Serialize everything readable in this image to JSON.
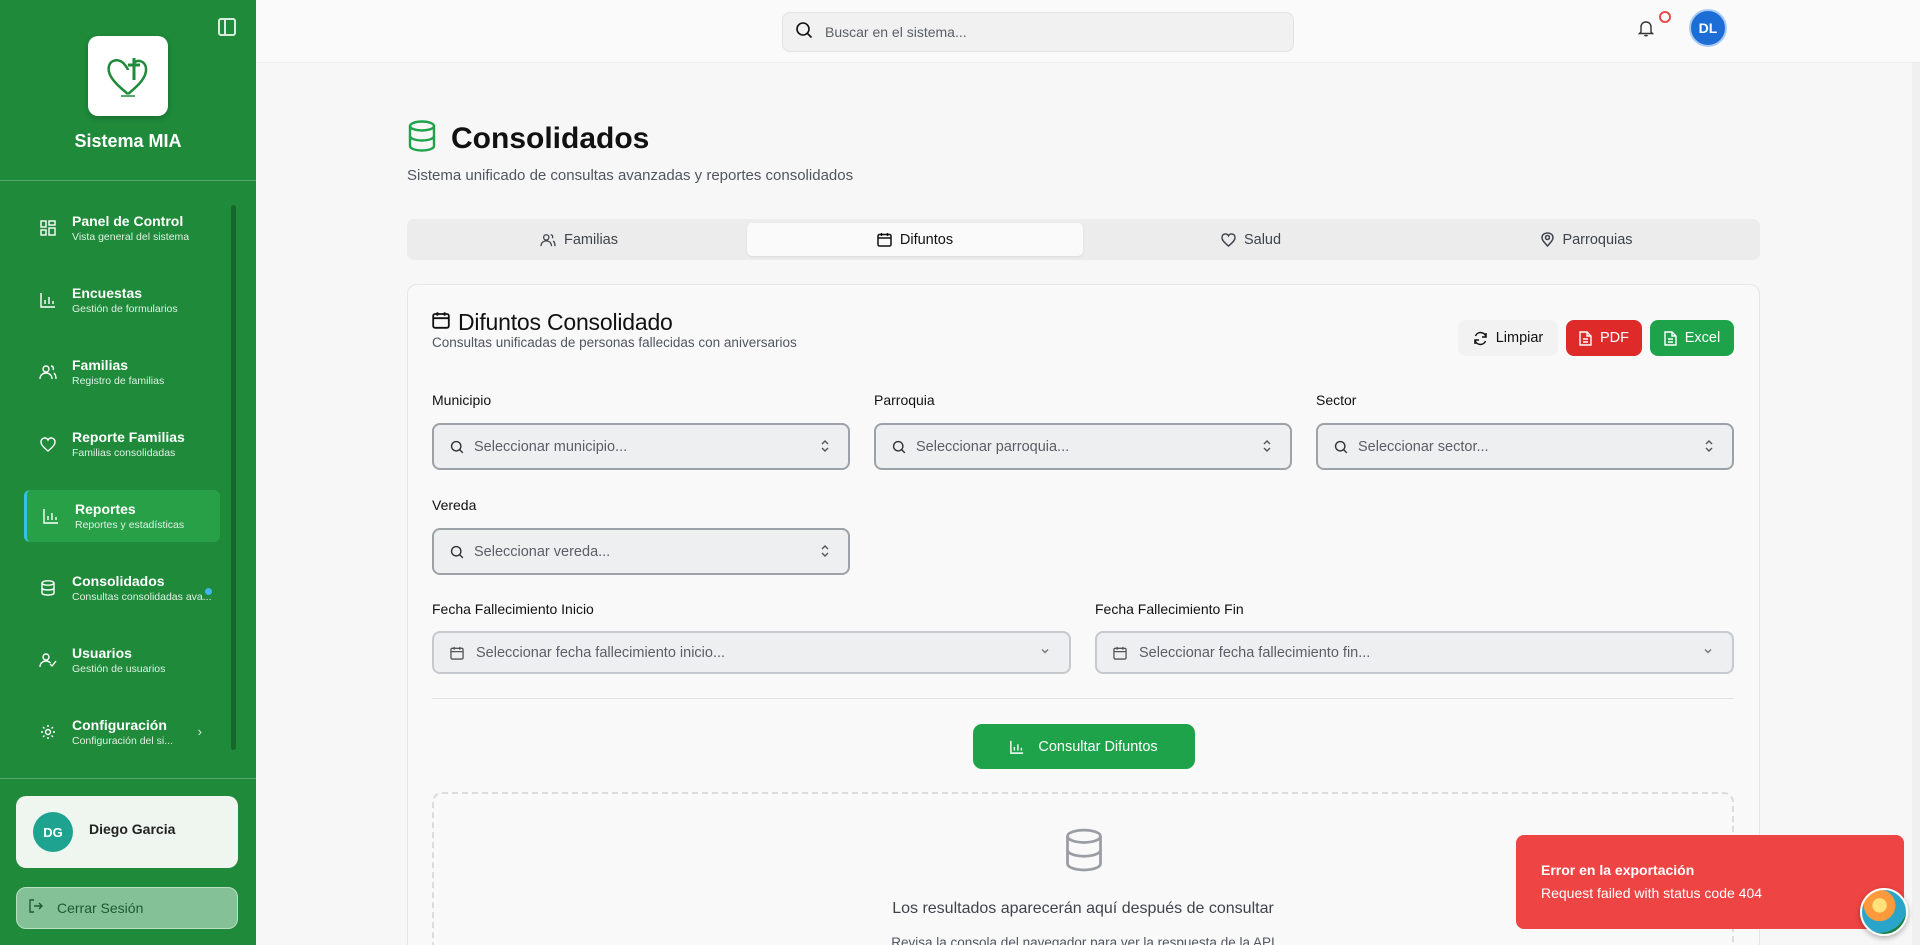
{
  "app": {
    "name": "Sistema MIA"
  },
  "search": {
    "placeholder": "Buscar en el sistema..."
  },
  "top_user": {
    "initials": "DL"
  },
  "sidebar": {
    "items": [
      {
        "title": "Panel de Control",
        "subtitle": "Vista general del sistema",
        "icon": "dashboard-icon"
      },
      {
        "title": "Encuestas",
        "subtitle": "Gestión de formularios",
        "icon": "chart-icon"
      },
      {
        "title": "Familias",
        "subtitle": "Registro de familias",
        "icon": "users-icon"
      },
      {
        "title": "Reporte Familias",
        "subtitle": "Familias consolidadas",
        "icon": "heart-icon"
      },
      {
        "title": "Reportes",
        "subtitle": "Reportes y estadísticas",
        "icon": "chart-icon"
      },
      {
        "title": "Consolidados",
        "subtitle": "Consultas consolidadas ava...",
        "icon": "database-icon"
      },
      {
        "title": "Usuarios",
        "subtitle": "Gestión de usuarios",
        "icon": "user-check-icon"
      },
      {
        "title": "Configuración",
        "subtitle": "Configuración del si...",
        "icon": "gear-icon"
      }
    ],
    "active_index": 4
  },
  "user": {
    "initials": "DG",
    "name": "Diego Garcia",
    "logout_label": "Cerrar Sesión"
  },
  "page": {
    "title": "Consolidados",
    "subtitle": "Sistema unificado de consultas avanzadas y reportes consolidados"
  },
  "tabs": [
    {
      "label": "Familias",
      "icon": "users-icon"
    },
    {
      "label": "Difuntos",
      "icon": "calendar-icon"
    },
    {
      "label": "Salud",
      "icon": "heart-icon"
    },
    {
      "label": "Parroquias",
      "icon": "map-pin-icon"
    }
  ],
  "active_tab": 1,
  "card": {
    "title": "Difuntos Consolidado",
    "subtitle": "Consultas unificadas de personas fallecidas con aniversarios",
    "buttons": {
      "clear": "Limpiar",
      "pdf": "PDF",
      "excel": "Excel"
    }
  },
  "filters": {
    "municipio": {
      "label": "Municipio",
      "placeholder": "Seleccionar municipio..."
    },
    "parroquia": {
      "label": "Parroquia",
      "placeholder": "Seleccionar parroquia..."
    },
    "sector": {
      "label": "Sector",
      "placeholder": "Seleccionar sector..."
    },
    "vereda": {
      "label": "Vereda",
      "placeholder": "Seleccionar vereda..."
    },
    "fecha_inicio": {
      "label": "Fecha Fallecimiento Inicio",
      "placeholder": "Seleccionar fecha fallecimiento inicio..."
    },
    "fecha_fin": {
      "label": "Fecha Fallecimiento Fin",
      "placeholder": "Seleccionar fecha fallecimiento fin..."
    }
  },
  "query_button": "Consultar Difuntos",
  "results": {
    "message": "Los resultados aparecerán aquí después de consultar",
    "hint": "Revisa la consola del navegador para ver la respuesta de la API"
  },
  "toast": {
    "title": "Error en la exportación",
    "message": "Request failed with status code 404",
    "color": "#ef4444"
  },
  "colors": {
    "sidebar": "#1e8a3a",
    "accent_green": "#1fa34a",
    "danger": "#df2a2a"
  }
}
